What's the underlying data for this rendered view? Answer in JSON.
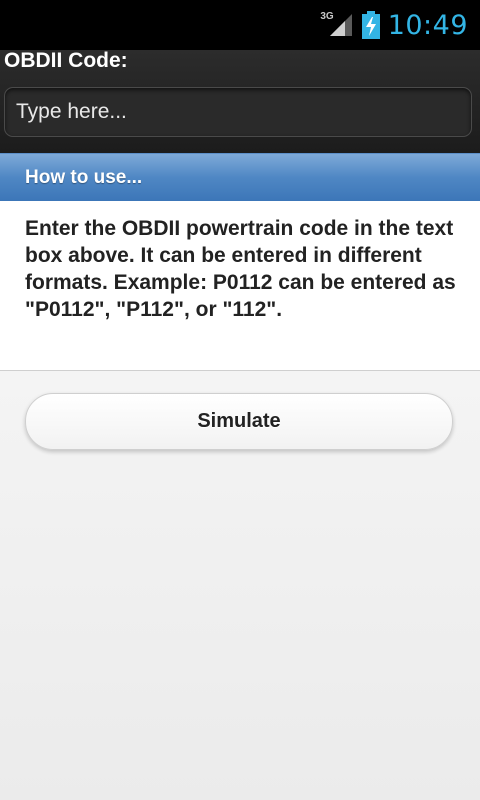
{
  "status_bar": {
    "network_type": "3G",
    "time": "10:49",
    "signal_icon": "signal-strength-icon",
    "battery_icon": "battery-charging-icon",
    "clock_color": "#33b5e5"
  },
  "header": {
    "label": "OBDII Code:",
    "input": {
      "value": "",
      "placeholder": "Type here..."
    }
  },
  "section": {
    "title": "How to use...",
    "title_bar_color": "#4f87c4",
    "body": "Enter the OBDII powertrain code in the text box above. It can be entered in different formats. Example: P0112 can be entered as \"P0112\", \"P112\", or \"112\"."
  },
  "actions": {
    "simulate_label": "Simulate"
  }
}
